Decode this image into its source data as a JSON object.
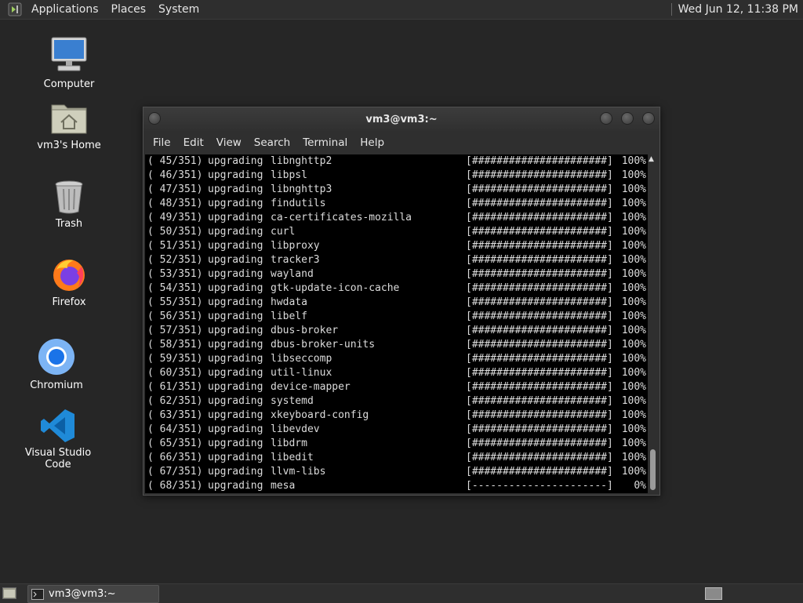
{
  "top_panel": {
    "menus": [
      "Applications",
      "Places",
      "System"
    ],
    "clock": "Wed Jun 12, 11:38 PM"
  },
  "desktop": {
    "icons": [
      {
        "label": "Computer",
        "icon": "computer-icon"
      },
      {
        "label": "vm3's Home",
        "icon": "home-folder-icon"
      },
      {
        "label": "Trash",
        "icon": "trash-icon"
      },
      {
        "label": "Firefox",
        "icon": "firefox-icon"
      },
      {
        "label": "Chromium",
        "icon": "chromium-icon"
      },
      {
        "label": "Visual Studio Code",
        "icon": "vscode-icon"
      }
    ]
  },
  "terminal": {
    "title": "vm3@vm3:~",
    "menus": [
      "File",
      "Edit",
      "View",
      "Search",
      "Terminal",
      "Help"
    ],
    "lines": [
      {
        "index": "( 45/351)",
        "action": "upgrading",
        "package": "libnghttp2",
        "bar": "[######################]",
        "percent": "100%"
      },
      {
        "index": "( 46/351)",
        "action": "upgrading",
        "package": "libpsl",
        "bar": "[######################]",
        "percent": "100%"
      },
      {
        "index": "( 47/351)",
        "action": "upgrading",
        "package": "libnghttp3",
        "bar": "[######################]",
        "percent": "100%"
      },
      {
        "index": "( 48/351)",
        "action": "upgrading",
        "package": "findutils",
        "bar": "[######################]",
        "percent": "100%"
      },
      {
        "index": "( 49/351)",
        "action": "upgrading",
        "package": "ca-certificates-mozilla",
        "bar": "[######################]",
        "percent": "100%"
      },
      {
        "index": "( 50/351)",
        "action": "upgrading",
        "package": "curl",
        "bar": "[######################]",
        "percent": "100%"
      },
      {
        "index": "( 51/351)",
        "action": "upgrading",
        "package": "libproxy",
        "bar": "[######################]",
        "percent": "100%"
      },
      {
        "index": "( 52/351)",
        "action": "upgrading",
        "package": "tracker3",
        "bar": "[######################]",
        "percent": "100%"
      },
      {
        "index": "( 53/351)",
        "action": "upgrading",
        "package": "wayland",
        "bar": "[######################]",
        "percent": "100%"
      },
      {
        "index": "( 54/351)",
        "action": "upgrading",
        "package": "gtk-update-icon-cache",
        "bar": "[######################]",
        "percent": "100%"
      },
      {
        "index": "( 55/351)",
        "action": "upgrading",
        "package": "hwdata",
        "bar": "[######################]",
        "percent": "100%"
      },
      {
        "index": "( 56/351)",
        "action": "upgrading",
        "package": "libelf",
        "bar": "[######################]",
        "percent": "100%"
      },
      {
        "index": "( 57/351)",
        "action": "upgrading",
        "package": "dbus-broker",
        "bar": "[######################]",
        "percent": "100%"
      },
      {
        "index": "( 58/351)",
        "action": "upgrading",
        "package": "dbus-broker-units",
        "bar": "[######################]",
        "percent": "100%"
      },
      {
        "index": "( 59/351)",
        "action": "upgrading",
        "package": "libseccomp",
        "bar": "[######################]",
        "percent": "100%"
      },
      {
        "index": "( 60/351)",
        "action": "upgrading",
        "package": "util-linux",
        "bar": "[######################]",
        "percent": "100%"
      },
      {
        "index": "( 61/351)",
        "action": "upgrading",
        "package": "device-mapper",
        "bar": "[######################]",
        "percent": "100%"
      },
      {
        "index": "( 62/351)",
        "action": "upgrading",
        "package": "systemd",
        "bar": "[######################]",
        "percent": "100%"
      },
      {
        "index": "( 63/351)",
        "action": "upgrading",
        "package": "xkeyboard-config",
        "bar": "[######################]",
        "percent": "100%"
      },
      {
        "index": "( 64/351)",
        "action": "upgrading",
        "package": "libevdev",
        "bar": "[######################]",
        "percent": "100%"
      },
      {
        "index": "( 65/351)",
        "action": "upgrading",
        "package": "libdrm",
        "bar": "[######################]",
        "percent": "100%"
      },
      {
        "index": "( 66/351)",
        "action": "upgrading",
        "package": "libedit",
        "bar": "[######################]",
        "percent": "100%"
      },
      {
        "index": "( 67/351)",
        "action": "upgrading",
        "package": "llvm-libs",
        "bar": "[######################]",
        "percent": "100%"
      },
      {
        "index": "( 68/351)",
        "action": "upgrading",
        "package": "mesa",
        "bar": "[----------------------]",
        "percent": "0%"
      }
    ]
  },
  "bottom_panel": {
    "task_label": "vm3@vm3:~"
  },
  "colors": {
    "desktop_bg": "#262626",
    "panel_bg": "#2e2e2e",
    "terminal_bg": "#000000",
    "terminal_fg": "#dcdcdc"
  }
}
